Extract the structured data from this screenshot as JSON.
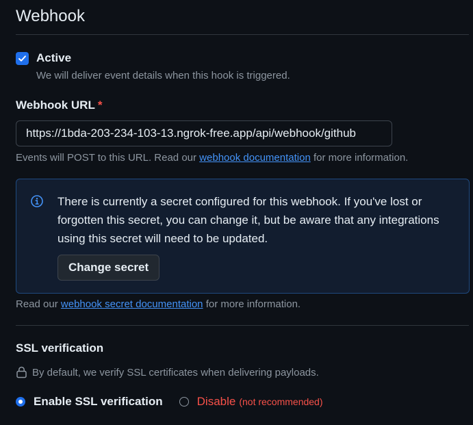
{
  "section": {
    "title": "Webhook"
  },
  "active": {
    "label": "Active",
    "checked": true,
    "hint": "We will deliver event details when this hook is triggered."
  },
  "url_field": {
    "label": "Webhook URL",
    "required_marker": "*",
    "value": "https://1bda-203-234-103-13.ngrok-free.app/api/webhook/github",
    "hint_before": "Events will POST to this URL. Read our",
    "hint_link": "webhook documentation",
    "hint_after": "for more information."
  },
  "secret_notice": {
    "icon": "info-icon",
    "message": "There is currently a secret configured for this webhook. If you've lost or forgotten this secret, you can change it, but be aware that any integrations using this secret will need to be updated.",
    "button_label": "Change secret"
  },
  "secret_hint": {
    "before": "Read our",
    "link": "webhook secret documentation",
    "after": "for more information."
  },
  "ssl": {
    "heading": "SSL verification",
    "hint": "By default, we verify SSL certificates when delivering payloads.",
    "hint_icon": "lock-icon",
    "options": [
      {
        "label": "Enable SSL verification",
        "selected": true
      },
      {
        "label": "Disable",
        "note": "(not recommended)",
        "selected": false
      }
    ]
  },
  "colors": {
    "background": "#0d1117",
    "accent": "#1f6feb",
    "link": "#4493f8",
    "danger": "#f85149",
    "notice_border": "#1f4a80"
  }
}
